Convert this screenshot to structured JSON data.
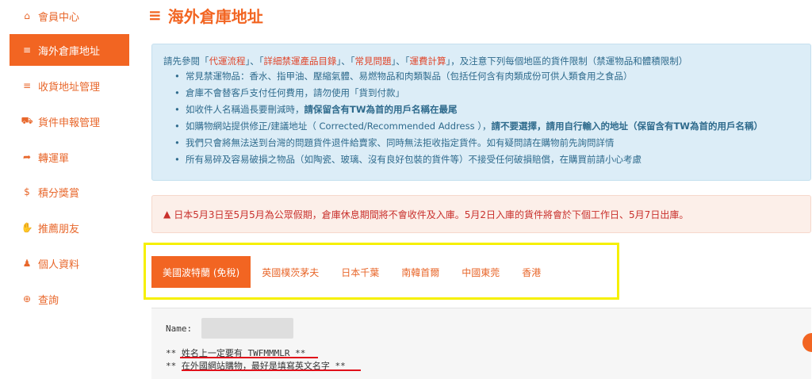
{
  "sidebar": {
    "items": [
      {
        "label": "會員中心",
        "icon": "home-icon",
        "glyph": "⌂"
      },
      {
        "label": "海外倉庫地址",
        "icon": "list-icon",
        "glyph": "≡"
      },
      {
        "label": "收貨地址管理",
        "icon": "list-icon",
        "glyph": "≡"
      },
      {
        "label": "貨件申報管理",
        "icon": "cart-icon",
        "glyph": "⛟"
      },
      {
        "label": "轉運單",
        "icon": "share-arrow-icon",
        "glyph": "➦"
      },
      {
        "label": "積分獎賞",
        "icon": "dollar-icon",
        "glyph": "$"
      },
      {
        "label": "推薦朋友",
        "icon": "thumbs-up-icon",
        "glyph": "✋"
      },
      {
        "label": "個人資料",
        "icon": "user-icon",
        "glyph": "♟"
      },
      {
        "label": "查詢",
        "icon": "lifebuoy-icon",
        "glyph": "⊕"
      }
    ]
  },
  "page": {
    "title": "海外倉庫地址",
    "title_glyph": "≡"
  },
  "info": {
    "lead_pre": "請先參閱「",
    "link1": "代運流程",
    "sep1": "」、「",
    "link2": "詳細禁運產品目錄",
    "sep2": "」、「",
    "link3": "常見問題",
    "sep3": "」、「",
    "link4": "運費計算",
    "lead_post": "」，及注意下列每個地區的貨件限制（禁運物品和體積限制）",
    "b1": "常見禁運物品：香水、指甲油、壓縮氣體、易燃物品和肉類製品（包括任何含有肉類成份可供人類食用之食品）",
    "b2": "倉庫不會替客戶支付任何費用，請勿使用「貨到付款」",
    "b3_pre": "如收件人名稱過長要刪減時，",
    "b3_bold": "請保留含有TW為首的用戶名稱在最尾",
    "b4_pre": "如購物網站提供修正/建議地址（ Corrected/Recommended Address ），",
    "b4_bold": "請不要選擇，請用自行輸入的地址（保留含有TW為首的用戶名稱）",
    "b5": "我們只會將無法送到台灣的問題貨件退件給賣家、同時無法拒收指定貨件。如有疑問請在購物前先詢問詳情",
    "b6": "所有易碎及容易破損之物品（如陶瓷、玻璃、沒有良好包裝的貨件等）不接受任何破損賠償，在購買前請小心考慮"
  },
  "alert": {
    "glyph": "▲",
    "text": "日本5月3日至5月5月為公眾假期，倉庫休息期間將不會收件及入庫。5月2日入庫的貨件將會於下個工作日、5月7日出庫。"
  },
  "tabs": [
    {
      "label": "美國波特蘭 (免稅)"
    },
    {
      "label": "英國樸茨茅夫"
    },
    {
      "label": "日本千葉"
    },
    {
      "label": "南韓首爾"
    },
    {
      "label": "中國東莞"
    },
    {
      "label": "香港"
    }
  ],
  "address": {
    "name_label": "Name:",
    "note1": "** 姓名上一定要有 TWFMMMLR **",
    "note2": "** 在外國網站購物，最好是填寫英文名字 **"
  },
  "colors": {
    "accent": "#f26522",
    "highlight": "#f6f000",
    "info_bg": "#dcedf7",
    "alert_bg": "#fcefe9",
    "underline": "#e0101a"
  }
}
